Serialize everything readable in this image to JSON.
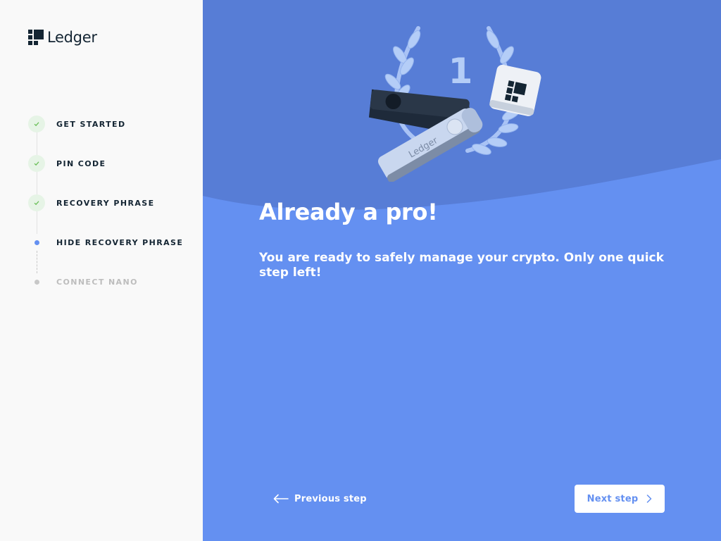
{
  "sidebar": {
    "logo_text": "Ledger",
    "steps": [
      {
        "label": "GET STARTED",
        "status": "done"
      },
      {
        "label": "PIN CODE",
        "status": "done"
      },
      {
        "label": "RECOVERY PHRASE",
        "status": "done"
      },
      {
        "label": "HIDE RECOVERY PHRASE",
        "status": "active"
      },
      {
        "label": "CONNECT NANO",
        "status": "todo"
      }
    ]
  },
  "main": {
    "illustration": {
      "trophy_number": "1",
      "device_brand": "Ledger"
    },
    "title": "Already a pro!",
    "subtitle": "You are ready to safely manage your crypto. Only one quick step left!"
  },
  "footer": {
    "previous_label": "Previous step",
    "next_label": "Next step"
  },
  "colors": {
    "accent": "#6490f1",
    "dark": "#142533",
    "success": "#66be54"
  }
}
